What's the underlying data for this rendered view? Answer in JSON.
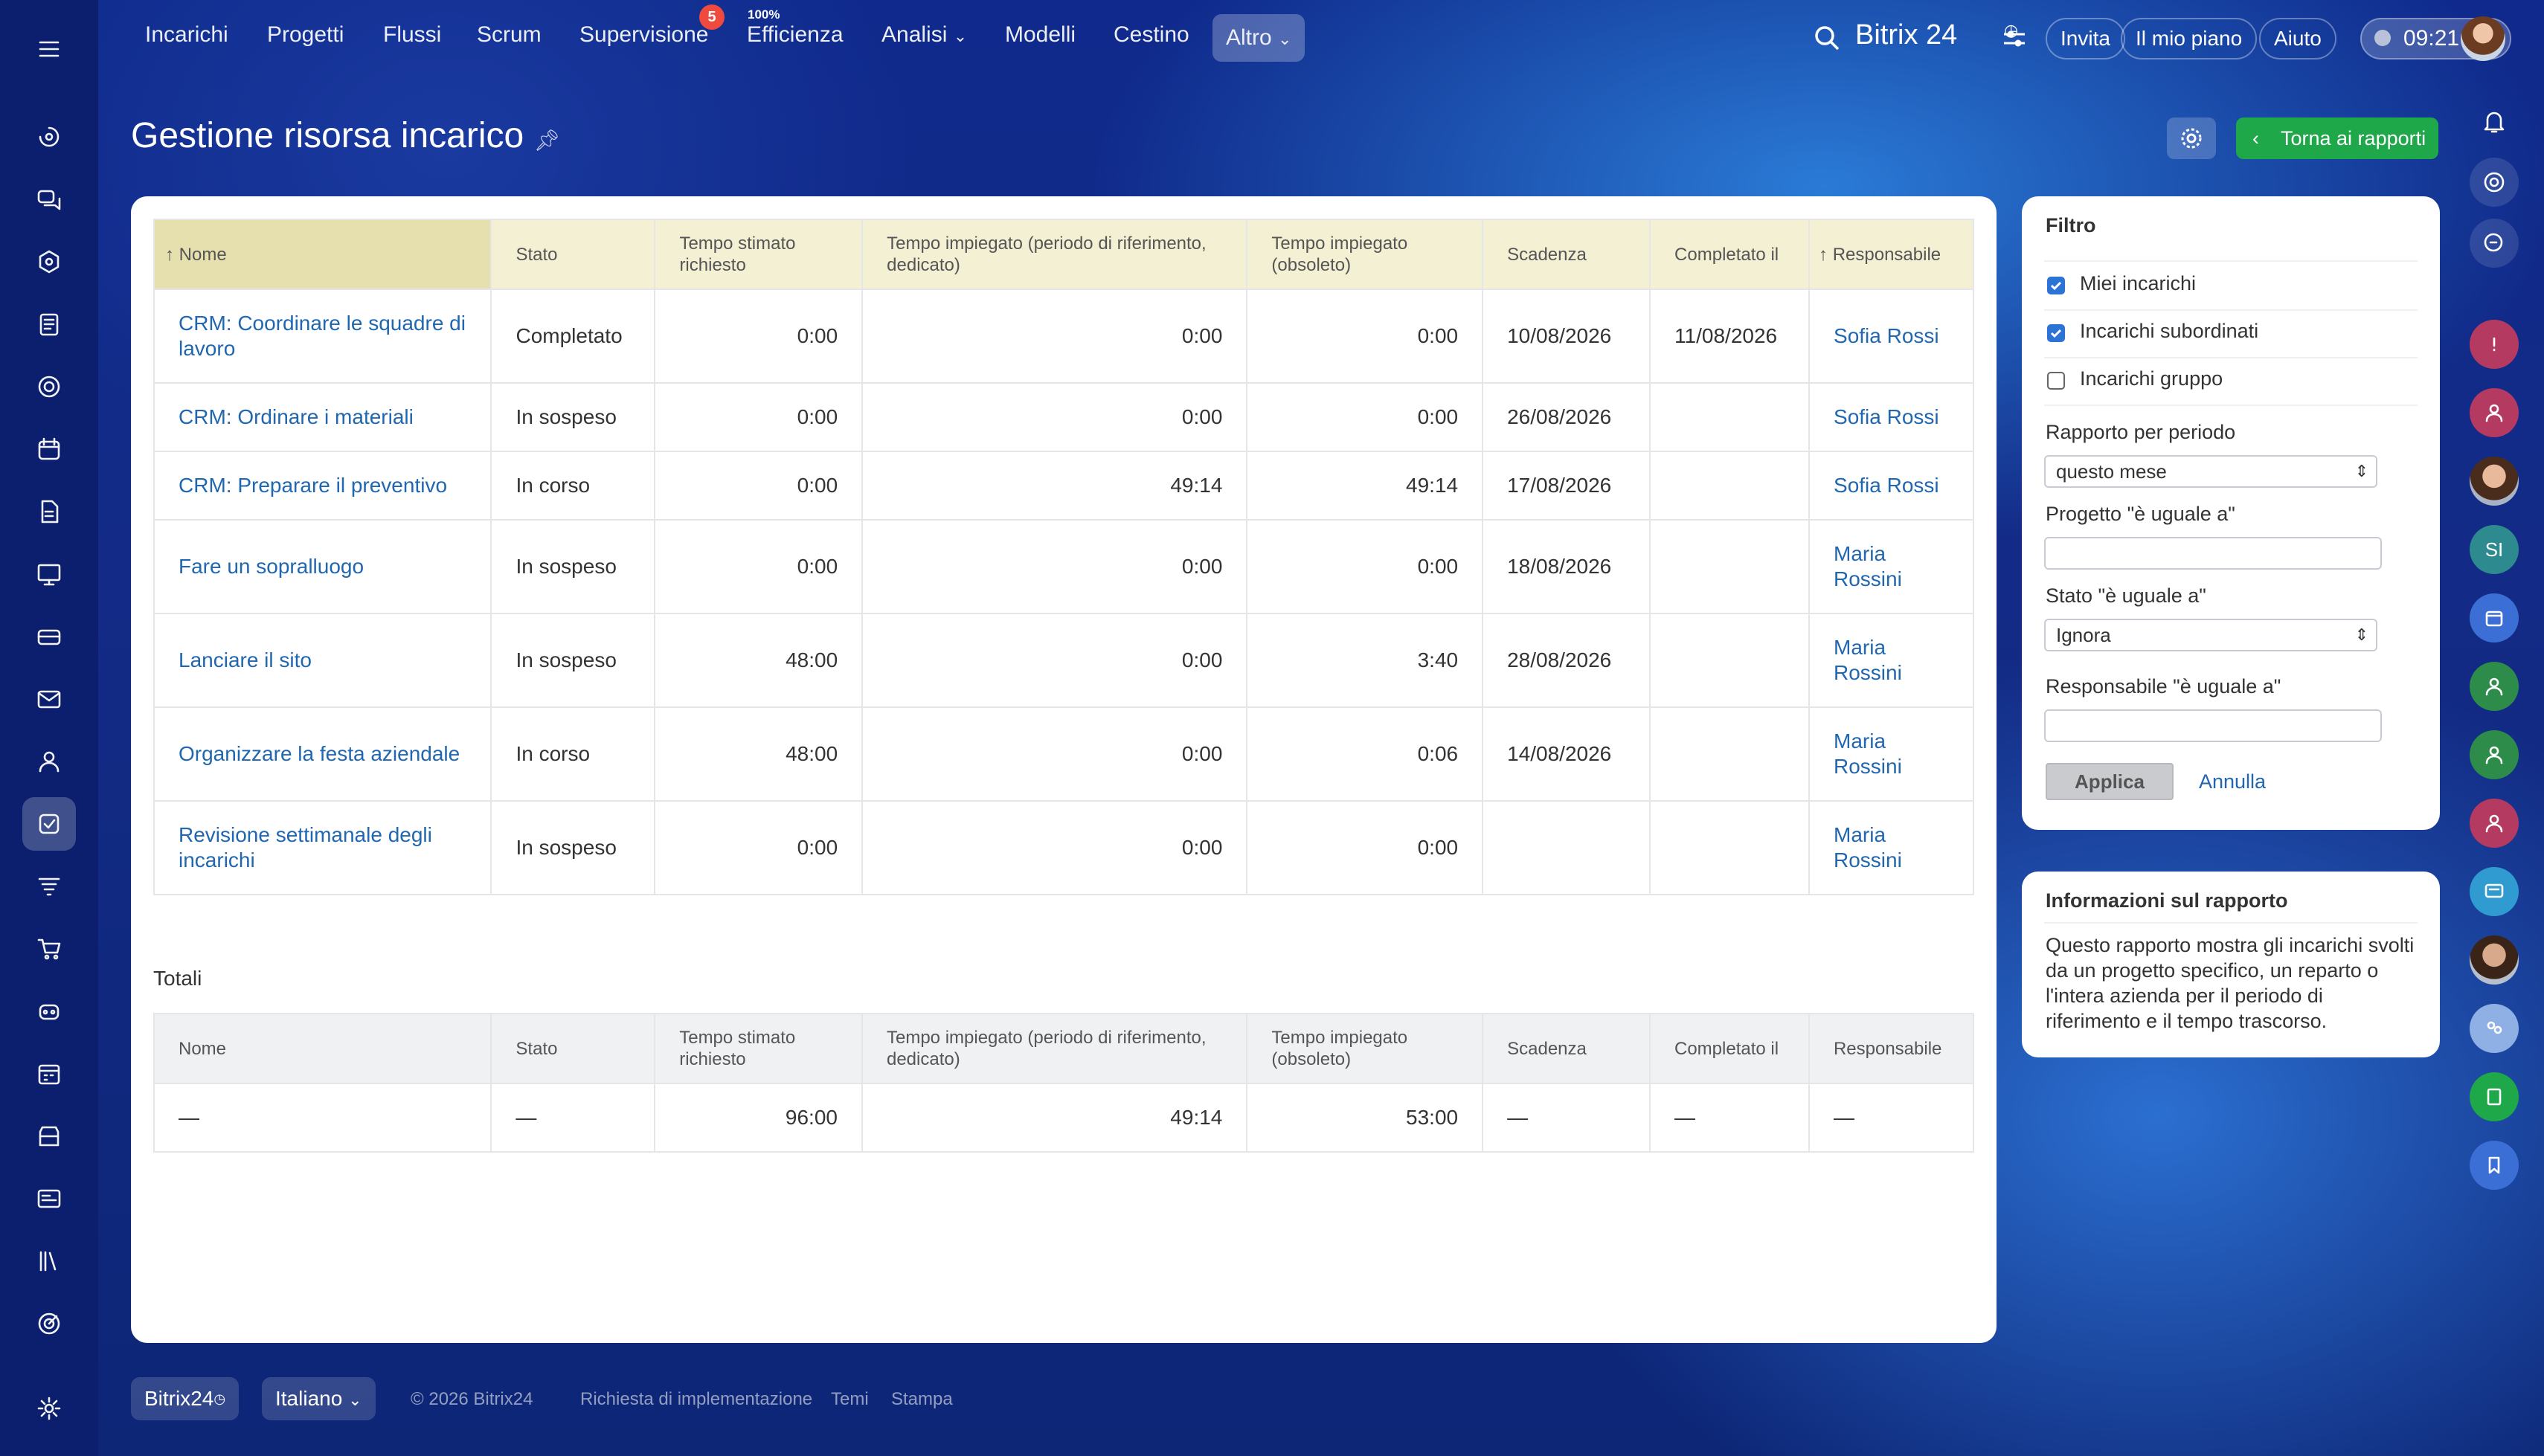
{
  "nav": {
    "items": [
      "Incarichi",
      "Progetti",
      "Flussi",
      "Scrum",
      "Supervisione",
      "Efficienza",
      "Analisi",
      "Modelli",
      "Cestino",
      "Altro"
    ],
    "supervisione_badge": "5",
    "efficienza_pct": "100%",
    "brand": "Bitrix 24",
    "invite": "Invita",
    "plan": "Il mio piano",
    "help": "Aiuto",
    "clock": "09:21"
  },
  "page": {
    "title": "Gestione risorsa incarico",
    "back_button": "Torna ai rapporti"
  },
  "table": {
    "columns": [
      "Nome",
      "Stato",
      "Tempo stimato richiesto",
      "Tempo impiegato (periodo di riferimento, dedicato)",
      "Tempo impiegato (obsoleto)",
      "Scadenza",
      "Completato il",
      "Responsabile"
    ],
    "rows": [
      {
        "name": "CRM: Coordinare le squadre di lavoro",
        "status": "Completato",
        "est": "0:00",
        "spent": "0:00",
        "old": "0:00",
        "due": "10/08/2026",
        "done": "11/08/2026",
        "resp": "Sofia Rossi"
      },
      {
        "name": "CRM: Ordinare i materiali",
        "status": "In sospeso",
        "est": "0:00",
        "spent": "0:00",
        "old": "0:00",
        "due": "26/08/2026",
        "done": "",
        "resp": "Sofia Rossi"
      },
      {
        "name": "CRM: Preparare il preventivo",
        "status": "In corso",
        "est": "0:00",
        "spent": "49:14",
        "old": "49:14",
        "due": "17/08/2026",
        "done": "",
        "resp": "Sofia Rossi"
      },
      {
        "name": "Fare un sopralluogo",
        "status": "In sospeso",
        "est": "0:00",
        "spent": "0:00",
        "old": "0:00",
        "due": "18/08/2026",
        "done": "",
        "resp": "Maria Rossini"
      },
      {
        "name": "Lanciare il sito",
        "status": "In sospeso",
        "est": "48:00",
        "spent": "0:00",
        "old": "3:40",
        "due": "28/08/2026",
        "done": "",
        "resp": "Maria Rossini"
      },
      {
        "name": "Organizzare la festa aziendale",
        "status": "In corso",
        "est": "48:00",
        "spent": "0:00",
        "old": "0:06",
        "due": "14/08/2026",
        "done": "",
        "resp": "Maria Rossini"
      },
      {
        "name": "Revisione settimanale degli incarichi",
        "status": "In sospeso",
        "est": "0:00",
        "spent": "0:00",
        "old": "0:00",
        "due": "",
        "done": "",
        "resp": "Maria Rossini"
      }
    ]
  },
  "totals": {
    "label": "Totali",
    "row": {
      "name": "—",
      "status": "—",
      "est": "96:00",
      "spent": "49:14",
      "old": "53:00",
      "due": "—",
      "done": "—",
      "resp": "—"
    }
  },
  "filter": {
    "title": "Filtro",
    "checks": [
      {
        "label": "Miei incarichi",
        "checked": true
      },
      {
        "label": "Incarichi subordinati",
        "checked": true
      },
      {
        "label": "Incarichi gruppo",
        "checked": false
      }
    ],
    "period_label": "Rapporto per periodo",
    "period_value": "questo mese",
    "project_label": "Progetto \"è uguale a\"",
    "project_value": "",
    "status_label": "Stato \"è uguale a\"",
    "status_value": "Ignora",
    "resp_label": "Responsabile \"è uguale a\"",
    "resp_value": "",
    "apply": "Applica",
    "cancel": "Annulla"
  },
  "info": {
    "title": "Informazioni sul rapporto",
    "text": "Questo rapporto mostra gli incarichi svolti da un progetto specifico, un reparto o l'intera azienda per il periodo di riferimento e il tempo trascorso."
  },
  "footer": {
    "brand": "Bitrix24",
    "language": "Italiano",
    "copyright": "© 2026 Bitrix24",
    "impl": "Richiesta di implementazione",
    "themes": "Temi",
    "print": "Stampa"
  },
  "colors": {
    "accent": "#2067b0",
    "green": "#1fa84a"
  }
}
